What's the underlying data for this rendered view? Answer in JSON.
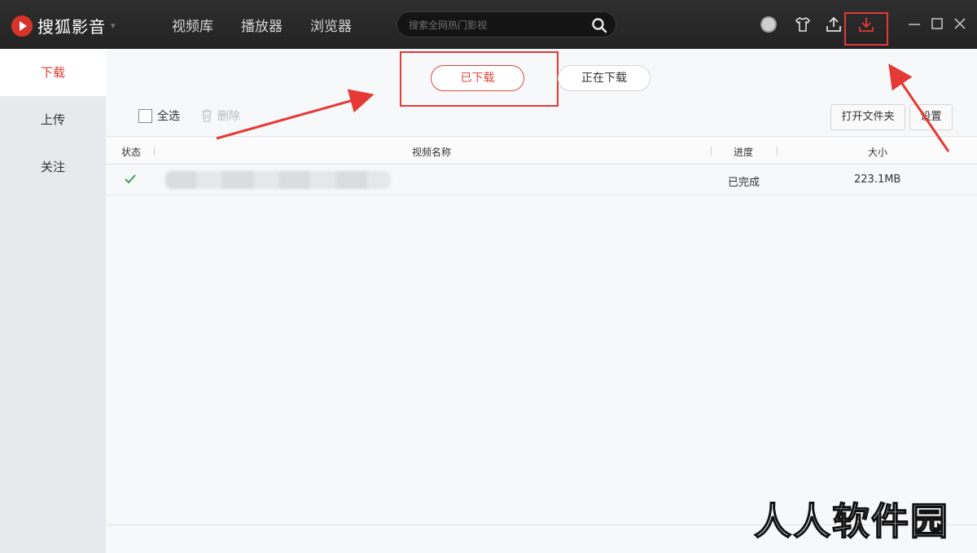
{
  "app": {
    "title": "搜狐影音"
  },
  "nav": {
    "items": [
      "视频库",
      "播放器",
      "浏览器"
    ]
  },
  "search": {
    "placeholder": "搜索全网热门影视"
  },
  "sidebar": {
    "items": [
      {
        "label": "下载",
        "active": true
      },
      {
        "label": "上传"
      },
      {
        "label": "关注"
      }
    ]
  },
  "tabs": {
    "downloaded": "已下载",
    "downloading": "正在下载"
  },
  "toolbar": {
    "select_all": "全选",
    "delete": "删除",
    "open_folder": "打开文件夹",
    "settings": "设置"
  },
  "table": {
    "headers": {
      "status": "状态",
      "name": "视频名称",
      "progress": "进度",
      "size": "大小"
    },
    "rows": [
      {
        "status_icon": "check-icon",
        "name": "",
        "progress": "已完成",
        "size": "223.1MB"
      }
    ]
  },
  "colors": {
    "accent": "#e0473d",
    "titlebar": "#2a2a2a",
    "success": "#3aa655",
    "annotation": "#e53935"
  },
  "watermark": {
    "text": "人人软件园"
  }
}
